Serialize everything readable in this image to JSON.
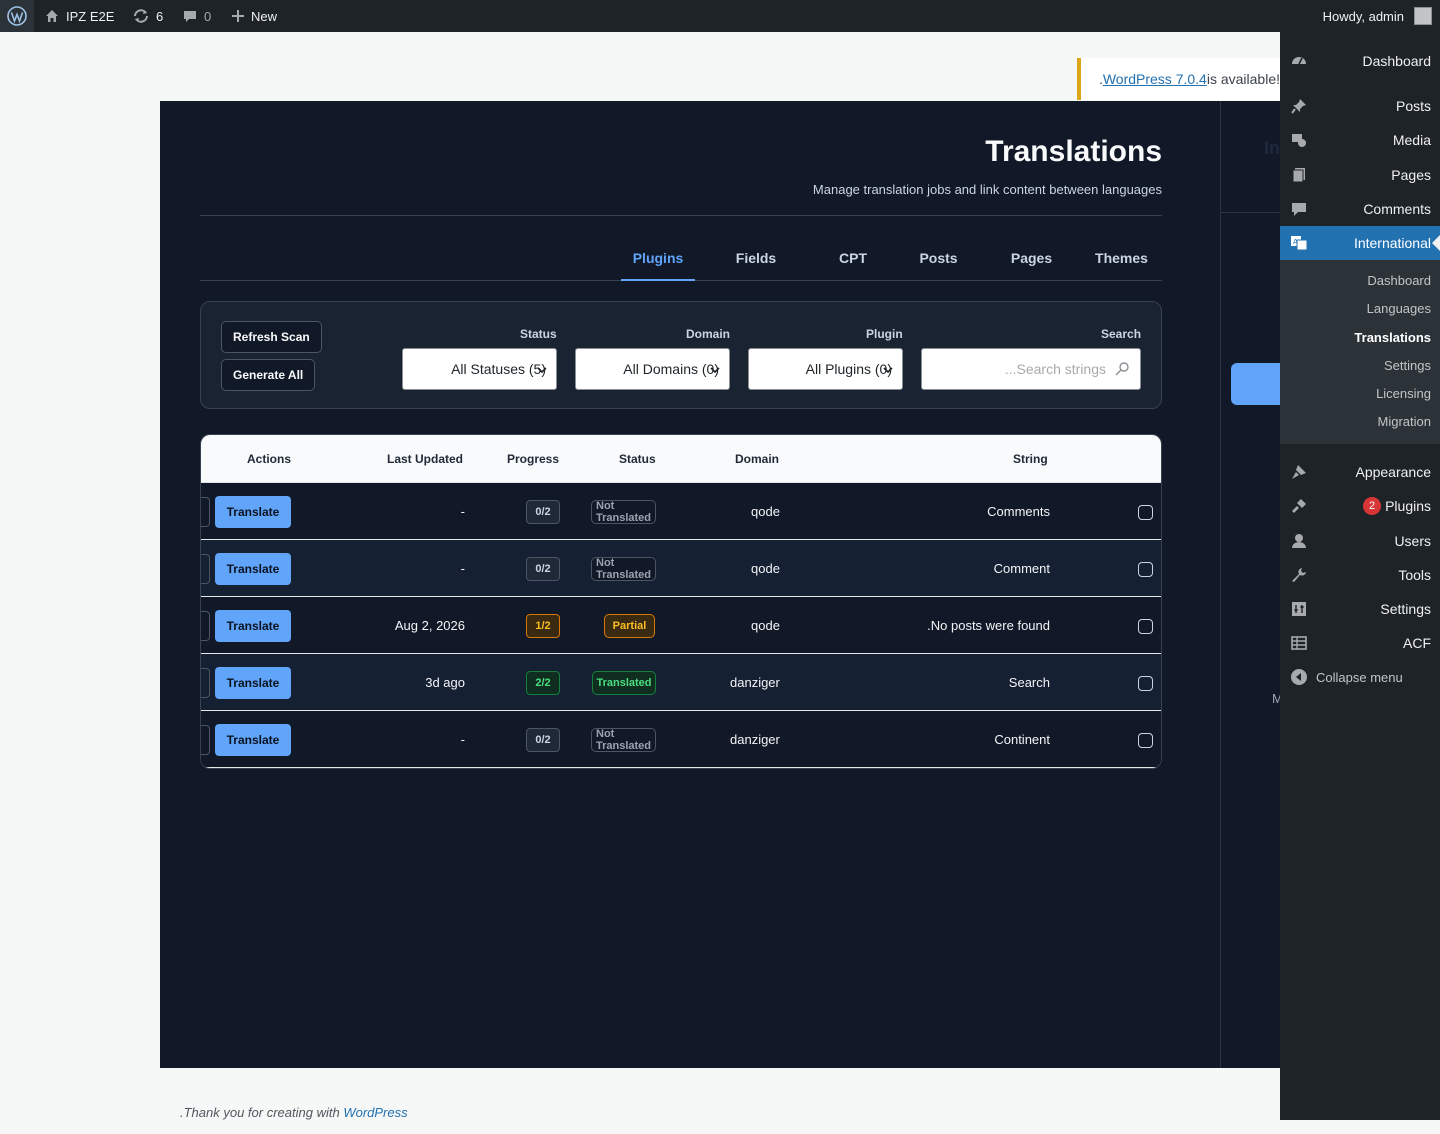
{
  "adminbar": {
    "site_name": "IPZ E2E",
    "updates_count": "6",
    "comments_count": "0",
    "new_label": "New",
    "howdy": "Howdy, admin"
  },
  "notice": {
    "link_text": "WordPress 7.0.4",
    "suffix": " is available!",
    "prefix": "."
  },
  "page": {
    "title": "Translations",
    "subtitle": "Manage translation jobs and link content between languages",
    "right_fragment_text": "In",
    "right_fragment_m": "M"
  },
  "tabs": [
    {
      "label": "Plugins",
      "active": true
    },
    {
      "label": "Fields",
      "active": false
    },
    {
      "label": "CPT",
      "active": false
    },
    {
      "label": "Posts",
      "active": false
    },
    {
      "label": "Pages",
      "active": false
    },
    {
      "label": "Themes",
      "active": false
    }
  ],
  "filters": {
    "refresh_label": "Refresh Scan",
    "generate_label": "Generate All",
    "status_label": "Status",
    "status_value": "All Statuses (5)",
    "domain_label": "Domain",
    "domain_value": "All Domains (0)",
    "plugin_label": "Plugin",
    "plugin_value": "All Plugins (0)",
    "search_label": "Search",
    "search_placeholder": "...Search strings"
  },
  "table": {
    "headers": {
      "actions": "Actions",
      "last_updated": "Last Updated",
      "progress": "Progress",
      "status": "Status",
      "domain": "Domain",
      "string": "String"
    },
    "rows": [
      {
        "action": "Translate",
        "updated": "-",
        "progress": "0/2",
        "status": "Not Translated",
        "domain": "qode",
        "string": "Comments"
      },
      {
        "action": "Translate",
        "updated": "-",
        "progress": "0/2",
        "status": "Not Translated",
        "domain": "qode",
        "string": "Comment"
      },
      {
        "action": "Translate",
        "updated": "Aug 2, 2026",
        "progress": "1/2",
        "status": "Partial",
        "domain": "qode",
        "string": ".No posts were found"
      },
      {
        "action": "Translate",
        "updated": "3d ago",
        "progress": "2/2",
        "status": "Translated",
        "domain": "danziger",
        "string": "Search"
      },
      {
        "action": "Translate",
        "updated": "-",
        "progress": "0/2",
        "status": "Not Translated",
        "domain": "danziger",
        "string": "Continent"
      }
    ]
  },
  "footer": {
    "prefix": ".Thank you for creating with ",
    "link": "WordPress"
  },
  "menu": {
    "items": [
      {
        "label": "Dashboard"
      },
      {
        "label": "Posts"
      },
      {
        "label": "Media"
      },
      {
        "label": "Pages"
      },
      {
        "label": "Comments"
      },
      {
        "label": "International"
      },
      {
        "label": "Appearance"
      },
      {
        "label": "Plugins",
        "badge": "2"
      },
      {
        "label": "Users"
      },
      {
        "label": "Tools"
      },
      {
        "label": "Settings"
      },
      {
        "label": "ACF"
      }
    ],
    "submenu": [
      {
        "label": "Dashboard"
      },
      {
        "label": "Languages"
      },
      {
        "label": "Translations"
      },
      {
        "label": "Settings"
      },
      {
        "label": "Licensing"
      },
      {
        "label": "Migration"
      }
    ],
    "collapse_label": "Collapse menu"
  },
  "colors": {
    "accent": "#60a5fa",
    "admin_bar": "#1d2327",
    "panel_bg": "#111827",
    "menu_current": "#2271b1",
    "partial": "#fbbf24",
    "translated": "#4ade80"
  }
}
